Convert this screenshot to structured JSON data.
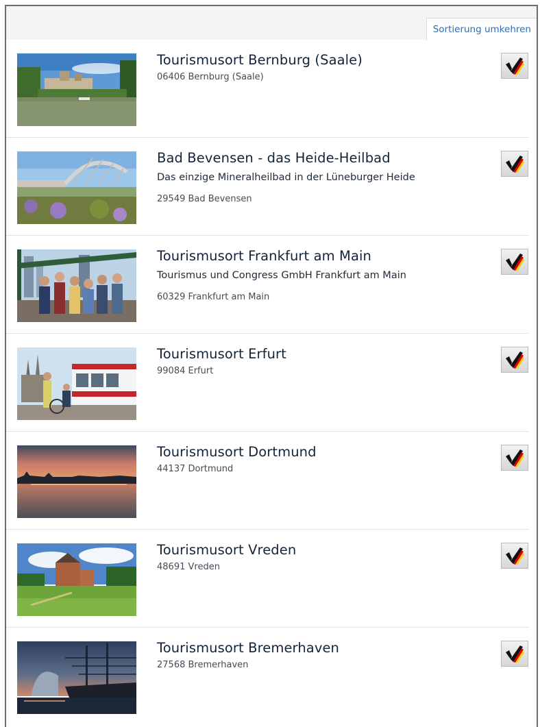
{
  "toolbar": {
    "sort_label": "Sortierung umkehren"
  },
  "badge": {
    "icon": "check-badge-icon",
    "colors": [
      "#000000",
      "#dd0000",
      "#ffce00"
    ]
  },
  "listings": [
    {
      "title": "Tourismusort Bernburg (Saale)",
      "subtitle": "",
      "address": "06406 Bernburg (Saale)",
      "image": "castle-by-river"
    },
    {
      "title": "Bad Bevensen - das Heide-Heilbad",
      "subtitle": "Das einzige Mineralheilbad in der Lüneburger Heide",
      "address": "29549 Bad Bevensen",
      "image": "spa-garden-pavilion"
    },
    {
      "title": "Tourismusort Frankfurt am Main",
      "subtitle": "Tourismus und Congress GmbH Frankfurt am Main",
      "address": "60329 Frankfurt am Main",
      "image": "group-on-bridge"
    },
    {
      "title": "Tourismusort Erfurt",
      "subtitle": "",
      "address": "99084 Erfurt",
      "image": "tram-and-cathedral"
    },
    {
      "title": "Tourismusort Dortmund",
      "subtitle": "",
      "address": "44137 Dortmund",
      "image": "sunset-lake-skyline"
    },
    {
      "title": "Tourismusort Vreden",
      "subtitle": "",
      "address": "48691 Vreden",
      "image": "castle-meadow"
    },
    {
      "title": "Tourismusort Bremerhaven",
      "subtitle": "",
      "address": "27568 Bremerhaven",
      "image": "harbour-at-dusk"
    }
  ]
}
